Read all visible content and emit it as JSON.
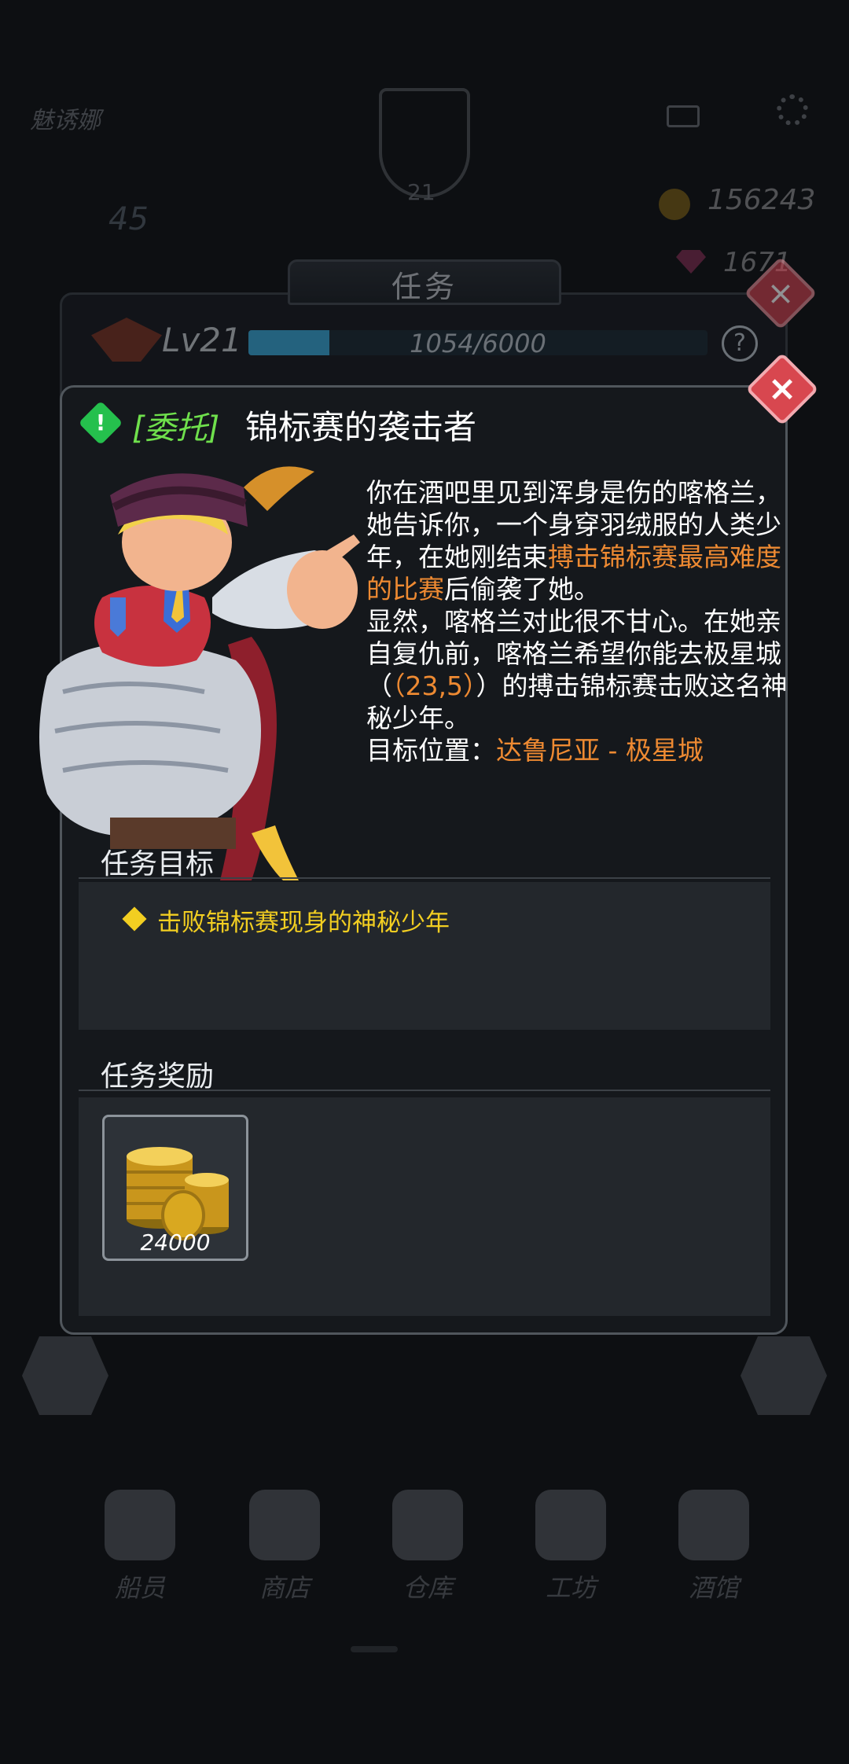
{
  "hud": {
    "player_name": "魅诱娜",
    "emblem_level": "21",
    "energy": "45",
    "coins": "156243",
    "gems": "1671"
  },
  "nav": [
    {
      "label": "船员"
    },
    {
      "label": "商店"
    },
    {
      "label": "仓库"
    },
    {
      "label": "工坊"
    },
    {
      "label": "酒馆"
    }
  ],
  "under_dialog": {
    "title": "任务",
    "level": "Lv21",
    "xp_text": "1054/6000",
    "xp_fraction": 0.1757,
    "help": "?"
  },
  "quest": {
    "tag": "[委托]",
    "title": "锦标赛的袭击者",
    "desc_1": "你在酒吧里见到浑身是伤的喀格兰，她告诉你，一个身穿羽绒服的人类少年，在她刚结束",
    "desc_hl_1": "搏击锦标赛最高难度的比赛",
    "desc_2": "后偷袭了她。",
    "desc_3": "显然，喀格兰对此很不甘心。在她亲自复仇前，喀格兰希望你能去极星城（",
    "desc_coords": "（23,5）",
    "desc_4": "）的搏击锦标赛击败这名神秘少年。",
    "target_label": "目标位置：",
    "target_value": "达鲁尼亚 - 极星城",
    "objective_heading": "任务目标",
    "objective": "击败锦标赛现身的神秘少年",
    "reward_heading": "任务奖励",
    "reward_amount": "24000"
  },
  "colors": {
    "highlight": "#ee8a32",
    "objective": "#f2ce21",
    "tag": "#6fe04c",
    "close": "#d8474f"
  },
  "icons": {
    "close": "×",
    "alert": "!"
  }
}
